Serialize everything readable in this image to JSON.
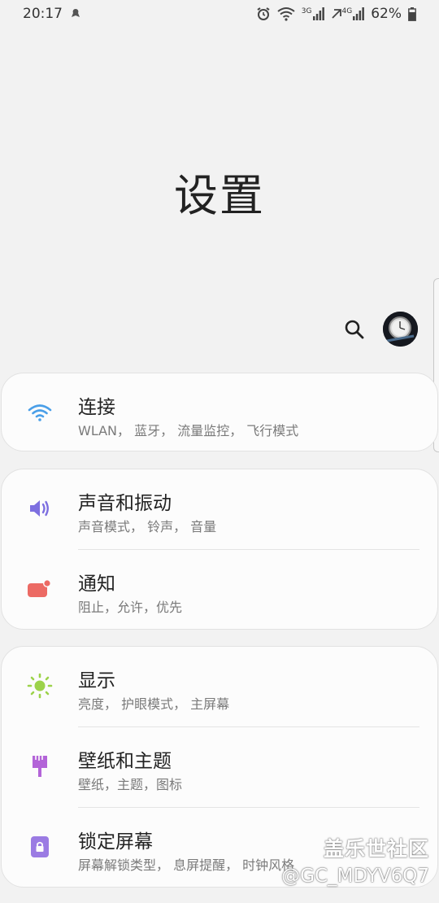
{
  "status_bar": {
    "time": "20:17",
    "battery": "62%",
    "net_3g": "3G",
    "net_4g": "4G"
  },
  "page_title": "设置",
  "cards": [
    {
      "items": [
        {
          "title": "连接",
          "subtitle": "WLAN， 蓝牙， 流量监控， 飞行模式",
          "icon": "wifi-icon",
          "icon_color": "#4a9fe8"
        }
      ]
    },
    {
      "items": [
        {
          "title": "声音和振动",
          "subtitle": "声音模式， 铃声， 音量",
          "icon": "volume-icon",
          "icon_color": "#7d6fe0"
        },
        {
          "title": "通知",
          "subtitle": "阻止，允许，优先",
          "icon": "notification-icon",
          "icon_color": "#ec6a64"
        }
      ]
    },
    {
      "items": [
        {
          "title": "显示",
          "subtitle": "亮度， 护眼模式， 主屏幕",
          "icon": "brightness-icon",
          "icon_color": "#9cd24a"
        },
        {
          "title": "壁纸和主题",
          "subtitle": "壁纸，主题，图标",
          "icon": "paintbrush-icon",
          "icon_color": "#b364d8"
        },
        {
          "title": "锁定屏幕",
          "subtitle": "屏幕解锁类型， 息屏提醒， 时钟风格",
          "icon": "lock-icon",
          "icon_color": "#9b7be3"
        }
      ]
    }
  ],
  "watermark": {
    "logo": "盖乐世社区",
    "user": "@GC_MDYV6Q7"
  }
}
